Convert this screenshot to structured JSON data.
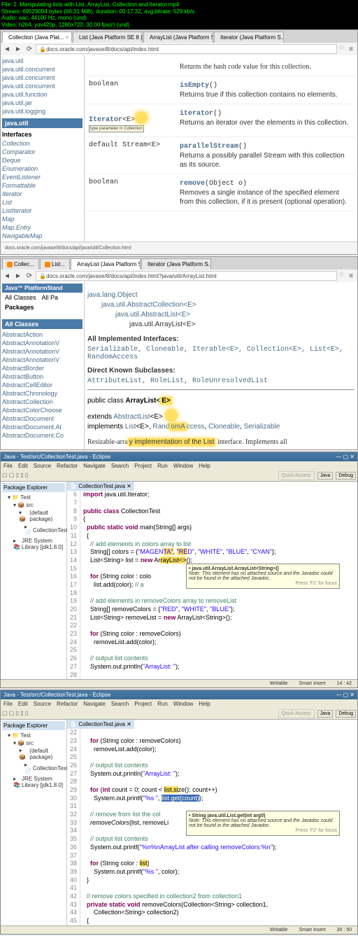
{
  "file_info": {
    "line1": "File: 2. Manipulating lists with List, ArrayList, Collection and Iterator.mp4",
    "line2": "Stream: 69529094 bytes (66.31 MiB), duration: 00:17:32, avg.bitrate: 529 kb/s",
    "line3": "Audio: aac, 44100 Hz, mono (und)",
    "line4": "Video: h264, yuv420p, 1280x720, 30.00 fps(r) (und)"
  },
  "browser1": {
    "tabs": [
      "Collection (Java Plat...",
      "List (Java Platform SE 8 )",
      "ArrayList (Java Platform S...",
      "Iterator (Java Platform S..."
    ],
    "url": "docs.oracle.com/javase/8/docs/api/index.html",
    "sidebar_pkgs": [
      "java.util",
      "java.util.concurrent",
      "java.util.concurrent",
      "java.util.concurrent",
      "java.util.function",
      "java.util.jar",
      "java.util.logging"
    ],
    "sidebar_head1": "java.util",
    "sidebar_head2": "Interfaces",
    "sidebar_ifaces": [
      "Collection",
      "Comparator",
      "Deque",
      "Enumeration",
      "EventListener",
      "Formattable",
      "Iterator",
      "List",
      "ListIterator",
      "Map",
      "Map.Entry",
      "NavigableMap"
    ],
    "methods": [
      {
        "ret": "",
        "name": "",
        "desc": "Returns the hash code value for this collection."
      },
      {
        "ret": "boolean",
        "sig": "isEmpty()",
        "name": "isEmpty",
        "desc": "Returns true if this collection contains no elements."
      },
      {
        "ret": "Iterator<E>",
        "sig": "iterator()",
        "name": "iterator",
        "desc": "Returns an iterator over the elements in this collection.",
        "highlight": true
      },
      {
        "ret": "default Stream<E>",
        "sig": "parallelStream()",
        "name": "parallelStream",
        "desc": "Returns a possibly parallel Stream with this collection as its source."
      },
      {
        "ret": "boolean",
        "sig": "remove(Object o)",
        "name": "remove",
        "desc": "Removes a single instance of the specified element from this collection, if it is present (optional operation)."
      }
    ],
    "bottom_url": "docs.oracle.com/javase/8/docs/api/java/util/Collection.html"
  },
  "browser2": {
    "tabs": [
      "Collec...",
      "List...",
      "ArrayList (Java Platform S...",
      "Iterator (Java Platform S..."
    ],
    "url": "docs.oracle.com/javase/8/docs/api/index.html?java/util/ArrayList.html",
    "platform": "Java™ PlatformStand",
    "allclasses": "All Classes",
    "allpkgs": "All Pa",
    "packages": "Packages",
    "allclasses_head": "All Classes",
    "class_list": [
      "AbstractAction",
      "AbstractAnnotationV",
      "AbstractAnnotationV",
      "AbstractAnnotationV",
      "AbstractBorder",
      "AbstractButton",
      "AbstractCellEditor",
      "AbstractChronology",
      "AbstractCollection",
      "AbstractColorChoose",
      "AbstractDocument",
      "AbstractDocument.At",
      "AbstractDocument.Co"
    ],
    "hierarchy": {
      "l1": "java.lang.Object",
      "l2": "java.util.AbstractCollection<E>",
      "l3": "java.util.AbstractList<E>",
      "l4": "java.util.ArrayList<E>"
    },
    "impl_head": "All Implemented Interfaces:",
    "impl_list": "Serializable, Cloneable, Iterable<E>, Collection<E>, List<E>, RandomAccess",
    "sub_head": "Direct Known Subclasses:",
    "sub_list": "AttributeList, RoleList, RoleUnresolvedList",
    "decl_l1": "public class ArrayList<E>",
    "decl_l2": "extends AbstractList<E>",
    "decl_l3": "implements List<E>, RandomAccess, Cloneable, Serializable",
    "desc": "Resizable-array implementation of the List interface. Implements all"
  },
  "eclipse1": {
    "title": "Java - Test/src/CollectionTest.java - Eclipse",
    "menu": [
      "File",
      "Edit",
      "Source",
      "Refactor",
      "Navigate",
      "Search",
      "Project",
      "Run",
      "Window",
      "Help"
    ],
    "quick_access": "Quick Access",
    "perspectives": [
      "Java",
      "Debug"
    ],
    "pkg_title": "Package Explorer",
    "tree": {
      "root": "Test",
      "src": "src",
      "pkg": "(default package)",
      "file": "CollectionTest.java",
      "jre": "JRE System Library [jdk1.8.0]"
    },
    "editor_tab": "CollectionTest.java",
    "tooltip": {
      "title": "java.util.ArrayList.ArrayList<String>()",
      "note": "Note: This element has no attached source and the Javadoc could not be found in the attached Javadoc.",
      "hint": "Press 'F2' for focus"
    },
    "status": {
      "writable": "Writable",
      "insert": "Smart Insert",
      "pos": "14 : 42"
    },
    "code_lines": {
      "6": {
        "n": "6",
        "t": "import java.util.Iterator;"
      },
      "7": {
        "n": "7",
        "t": ""
      },
      "8": {
        "n": "8",
        "t": "public class CollectionTest"
      },
      "9": {
        "n": "9",
        "t": "{"
      },
      "10": {
        "n": "10",
        "t": "  public static void main(String[] args)"
      },
      "11": {
        "n": "11",
        "t": "  {"
      },
      "12": {
        "n": "12",
        "t": "    // add elements in colors array to list"
      },
      "13": {
        "n": "13",
        "t": "    String[] colors = {\"MAGENTA\", \"RED\", \"WHITE\", \"BLUE\", \"CYAN\"};"
      },
      "14": {
        "n": "14",
        "t": "    List<String> list = new ArrayList<>();"
      },
      "15": {
        "n": "15",
        "t": ""
      },
      "16": {
        "n": "16",
        "t": "    for (String color : colo"
      },
      "17": {
        "n": "17",
        "t": "      list.add(color); // a"
      },
      "18": {
        "n": "18",
        "t": ""
      },
      "19": {
        "n": "19",
        "t": "    // add elements in removeColors array to removeList"
      },
      "20": {
        "n": "20",
        "t": "    String[] removeColors = {\"RED\", \"WHITE\", \"BLUE\"};"
      },
      "21": {
        "n": "21",
        "t": "    List<String> removeList = new ArrayList<String>();"
      },
      "22": {
        "n": "22",
        "t": ""
      },
      "23": {
        "n": "23",
        "t": "    for (String color : removeColors)"
      },
      "24": {
        "n": "24",
        "t": "      removeList.add(color);"
      },
      "25": {
        "n": "25",
        "t": ""
      },
      "26": {
        "n": "26",
        "t": "    // output list contents"
      },
      "27": {
        "n": "27",
        "t": "    System.out.println(\"ArrayList: \");"
      },
      "28": {
        "n": "28",
        "t": ""
      }
    }
  },
  "eclipse2": {
    "title": "Java - Test/src/CollectionTest.java - Eclipse",
    "tooltip": {
      "title": "String java.util.List.get(int arg0)",
      "note": "Note: This element has no attached source and the Javadoc could not be found in the attached Javadoc.",
      "hint": "Press 'F2' for focus"
    },
    "status": {
      "writable": "Writable",
      "insert": "Smart Insert",
      "pos": "30 : 50"
    },
    "code_lines": {
      "22": {
        "n": "22",
        "t": ""
      },
      "23": {
        "n": "23",
        "t": "    for (String color : removeColors)"
      },
      "24": {
        "n": "24",
        "t": "      removeList.add(color);"
      },
      "25": {
        "n": "25",
        "t": ""
      },
      "26": {
        "n": "26",
        "t": "    // output list contents"
      },
      "27": {
        "n": "27",
        "t": "    System.out.println(\"ArrayList: \");"
      },
      "28": {
        "n": "28",
        "t": ""
      },
      "29": {
        "n": "29",
        "t": "    for (int count = 0; count < list.size(); count++)"
      },
      "30": {
        "n": "30",
        "t": "      System.out.printf(\"%s \", list.get(count));"
      },
      "31": {
        "n": "31",
        "t": ""
      },
      "32": {
        "n": "32",
        "t": "    // remove from list the col"
      },
      "33": {
        "n": "33",
        "t": "    removeColors(list, removeLi"
      },
      "34": {
        "n": "34",
        "t": ""
      },
      "35": {
        "n": "35",
        "t": "    // output list contents"
      },
      "36": {
        "n": "36",
        "t": "    System.out.printf(\"%n%nArrayList after calling removeColors:%n\");"
      },
      "37": {
        "n": "37",
        "t": ""
      },
      "38": {
        "n": "38",
        "t": "    for (String color : list)"
      },
      "39": {
        "n": "39",
        "t": "      System.out.printf(\"%s \", color);"
      },
      "40": {
        "n": "40",
        "t": "  }"
      },
      "41": {
        "n": "41",
        "t": ""
      },
      "42": {
        "n": "42",
        "t": "  // remove colors specified in collection2 from collection1"
      },
      "43": {
        "n": "43",
        "t": "  private static void removeColors(Collection<String> collection1,"
      },
      "44": {
        "n": "44",
        "t": "      Collection<String> collection2)"
      },
      "45": {
        "n": "45",
        "t": "  {"
      }
    }
  }
}
